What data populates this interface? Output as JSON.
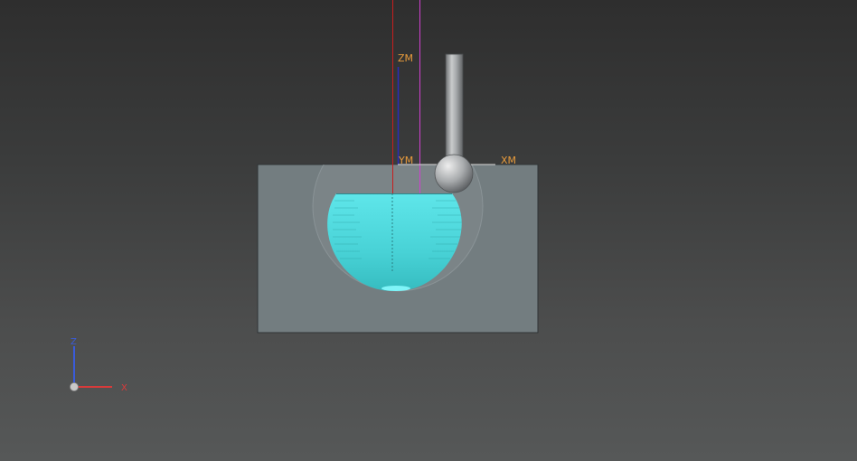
{
  "scene": {
    "machine_axes": {
      "z_label": "ZM",
      "y_label": "YM",
      "x_label": "XM",
      "label_color": "#e89b3c"
    },
    "triad": {
      "z_label": "Z",
      "x_label": "X",
      "z_color": "#3a5bd9",
      "x_color": "#d83a3a"
    },
    "colors": {
      "workpiece": "#737d80",
      "cut_region": "#4fd8dc",
      "tool": "#a4a7a9",
      "line_red": "#c81e1e",
      "line_magenta": "#d040d0",
      "line_blue": "#2a2ab8"
    },
    "icons": {
      "tool": "ball-end-mill-icon",
      "triad": "axis-triad-icon"
    }
  }
}
